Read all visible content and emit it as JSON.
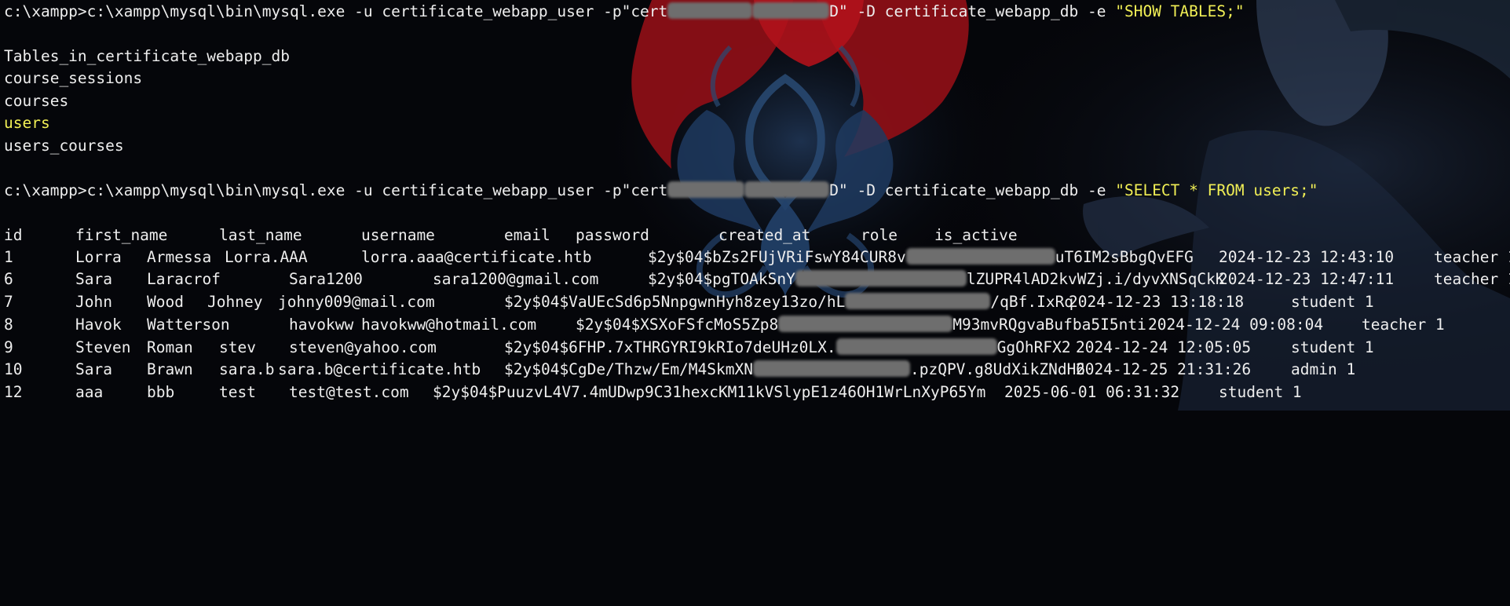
{
  "theme": {
    "background": "#05060a",
    "text": "#eeeeee",
    "highlight": "#f1ef55",
    "logo_red": "#a3111a",
    "logo_blue": "#1f3e64"
  },
  "cmd1": {
    "a": "c:\\xampp>c:\\xampp\\mysql\\bin\\mysql.exe -u certificate_webapp_user -p\"cert",
    "b": "D\" -D certificate_webapp_db -e ",
    "c": "\"SHOW TABLES;\""
  },
  "tables_header": "Tables_in_certificate_webapp_db",
  "tables": [
    "course_sessions",
    "courses",
    "users",
    "users_courses"
  ],
  "cmd2": {
    "a": "c:\\xampp>c:\\xampp\\mysql\\bin\\mysql.exe -u certificate_webapp_user -p\"cert",
    "b": "D\" -D certificate_webapp_db -e ",
    "c": "\"SELECT * FROM users;\""
  },
  "columns": [
    "id",
    "first_name",
    "last_name",
    "username",
    "email",
    "password",
    "created_at",
    "role",
    "is_active"
  ],
  "rows": [
    {
      "a": "1",
      "b": "Lorra",
      "c": "Armessa",
      "d": "Lorra.AAA",
      "e": "lorra.aaa@certificate.htb",
      "f": "$2y$04$bZs2FUjVRiFswY84CUR8v",
      "g": "uT6IM2sBbgQvEFG",
      "h": "2024-12-23 12:43:10",
      "i": "teacher 1"
    },
    {
      "a": "6",
      "b": "Sara",
      "c": "Laracrof",
      "d": "Sara1200",
      "e": "sara1200@gmail.com",
      "f": "$2y$04$pgTOAkSnY",
      "g": "lZUPR4lAD2kvWZj.i/dyvXNSqCkK",
      "h": "2024-12-23 12:47:11",
      "i": "teacher 1"
    },
    {
      "a": "7",
      "b": "John",
      "c": "Wood",
      "d": "Johney",
      "e": "johny009@mail.com",
      "f": "$2y$04$VaUEcSd6p5NnpgwnHyh8zey13zo/hL",
      "g": "/qBf.IxRq",
      "h": "2024-12-23 13:18:18",
      "i": "student 1"
    },
    {
      "a": "8",
      "b": "Havok",
      "c": "Watterson",
      "d": "havokww",
      "e": "havokww@hotmail.com",
      "f": "$2y$04$XSXoFSfcMoS5Zp8",
      "g": "M93mvRQgvaBufba5I5nti",
      "h": "2024-12-24 09:08:04",
      "i": "teacher 1"
    },
    {
      "a": "9",
      "b": "Steven",
      "c": "Roman",
      "d": "stev",
      "e": "steven@yahoo.com",
      "f": "$2y$04$6FHP.7xTHRGYRI9kRIo7deUHz0LX.",
      "g": "GgOhRFX2",
      "h": "2024-12-24 12:05:05",
      "i": "student 1"
    },
    {
      "a": "10",
      "b": "Sara",
      "c": "Brawn",
      "d": "sara.b",
      "e": "sara.b@certificate.htb",
      "f": "$2y$04$CgDe/Thzw/Em/M4SkmXN",
      "g": ".pzQPV.g8UdXikZNdH6",
      "h": "2024-12-25 21:31:26",
      "i": "admin 1"
    },
    {
      "a": "12",
      "b": "aaa",
      "c": "bbb",
      "d": "test",
      "e": "test@test.com",
      "f": "$2y$04$PuuzvL4V7.4mUDwp9C31hexcKM11kVSlypE1z46OH1WrLnXyP65Ym",
      "g": "",
      "h": "2025-06-01 06:31:32",
      "i": "student 1"
    }
  ]
}
